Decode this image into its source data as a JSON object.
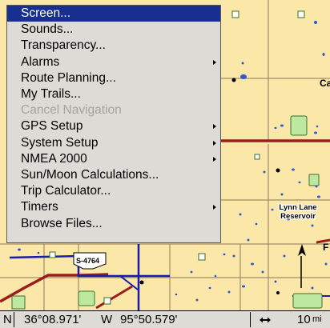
{
  "menu": {
    "items": [
      {
        "label": "Screen...",
        "selected": true,
        "disabled": false,
        "submenu": false
      },
      {
        "label": "Sounds...",
        "selected": false,
        "disabled": false,
        "submenu": false
      },
      {
        "label": "Transparency...",
        "selected": false,
        "disabled": false,
        "submenu": false
      },
      {
        "label": "Alarms",
        "selected": false,
        "disabled": false,
        "submenu": true
      },
      {
        "label": "Route Planning...",
        "selected": false,
        "disabled": false,
        "submenu": false
      },
      {
        "label": "My Trails...",
        "selected": false,
        "disabled": false,
        "submenu": false
      },
      {
        "label": "Cancel Navigation",
        "selected": false,
        "disabled": true,
        "submenu": false
      },
      {
        "label": "GPS Setup",
        "selected": false,
        "disabled": false,
        "submenu": true
      },
      {
        "label": "System Setup",
        "selected": false,
        "disabled": false,
        "submenu": true
      },
      {
        "label": "NMEA 2000",
        "selected": false,
        "disabled": false,
        "submenu": true
      },
      {
        "label": "Sun/Moon Calculations...",
        "selected": false,
        "disabled": false,
        "submenu": false
      },
      {
        "label": "Trip Calculator...",
        "selected": false,
        "disabled": false,
        "submenu": false
      },
      {
        "label": "Timers",
        "selected": false,
        "disabled": false,
        "submenu": true
      },
      {
        "label": "Browse Files...",
        "selected": false,
        "disabled": false,
        "submenu": false
      }
    ]
  },
  "map": {
    "place_label_line1": "Lynn Lane",
    "place_label_line2": "Reservoir",
    "road_label": "S-4764",
    "edge_letter_c": "Ca",
    "edge_letter_f": "F"
  },
  "status": {
    "lat_hemisphere": "N",
    "latitude": "36°08.971'",
    "lon_hemisphere": "W",
    "longitude": "95°50.579'",
    "zoom_value": "10",
    "zoom_unit": "mi"
  },
  "icons": {
    "zoom": "horizontal-double-arrow-icon",
    "submenu": "submenu-arrow-icon",
    "position": "position-arrow-icon"
  },
  "colors": {
    "land": "#fbe8a8",
    "road_major": "#9b1c1c",
    "road_secondary": "#1a1ab0",
    "water": "#2f56d8",
    "park": "#bde8a0",
    "menu_bg": "#dcdbd6",
    "menu_highlight": "#172f8f",
    "disabled_text": "#a3a3a0"
  }
}
